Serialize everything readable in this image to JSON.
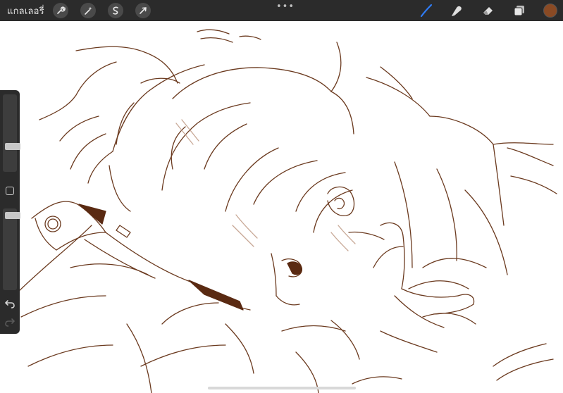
{
  "topbar": {
    "gallery_label": "แกลเลอรี่",
    "left_tools": [
      "wrench-icon",
      "magic-wand-icon",
      "selection-icon",
      "transform-arrow-icon"
    ],
    "more_dots": "•••",
    "right_tools": [
      "brush-icon",
      "smudge-icon",
      "eraser-icon",
      "layers-icon"
    ],
    "brush_active_color": "#2f7cf6",
    "current_color": "#8a4a24"
  },
  "sidebar": {
    "size_slider_level": 0.31,
    "opacity_slider_level": 0.95
  },
  "theme": {
    "toolbar_bg": "#2b2b2b",
    "line_color": "#6b3a1f",
    "fill_color": "#5a2a12"
  }
}
